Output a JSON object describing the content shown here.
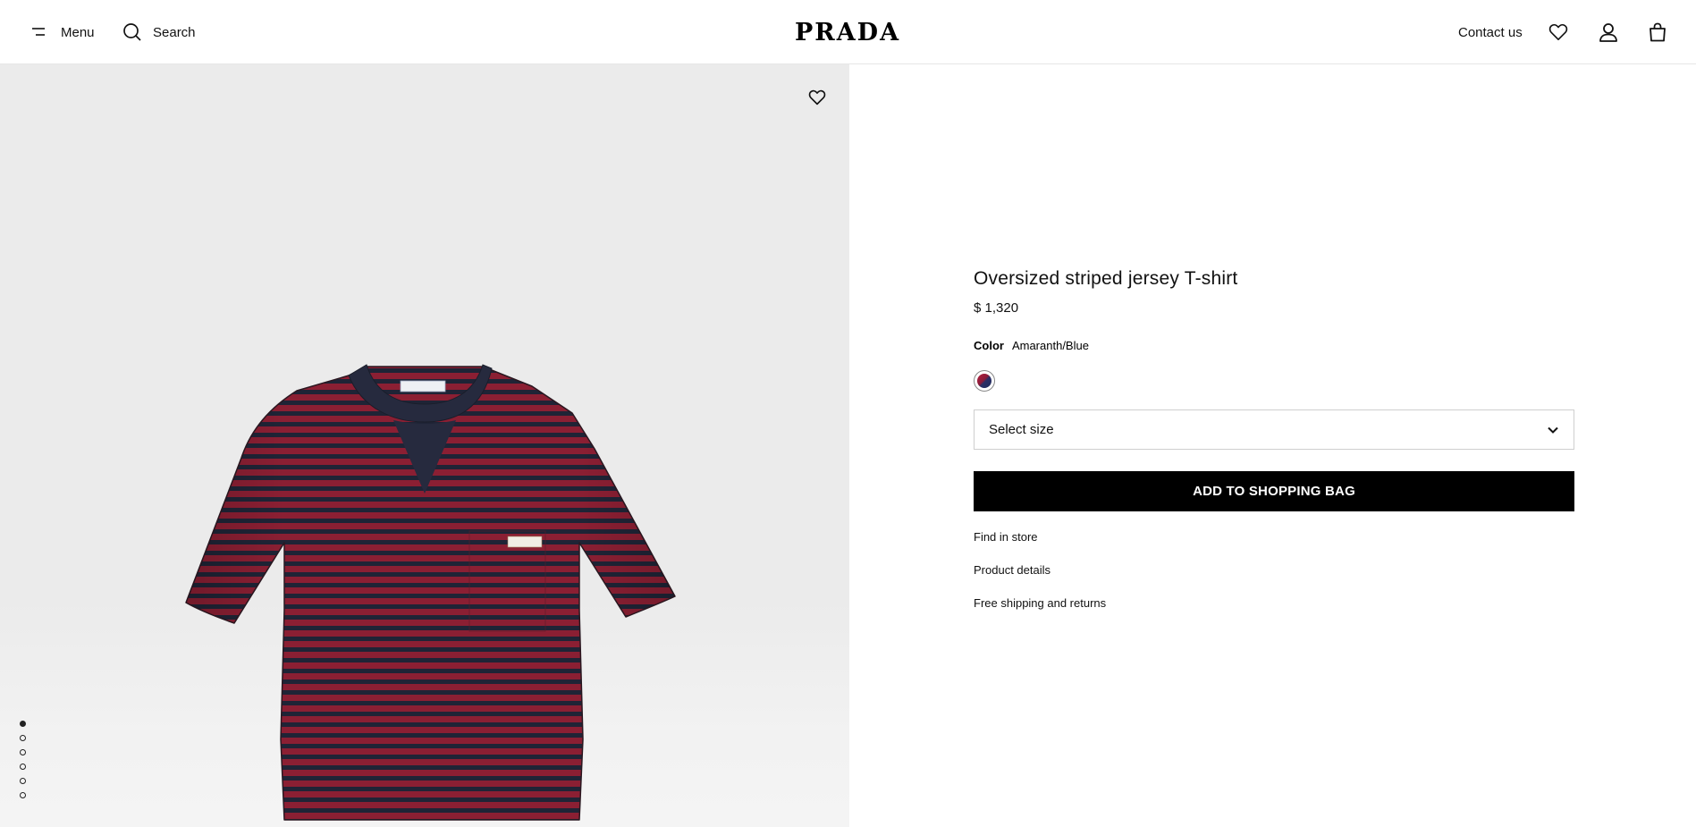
{
  "header": {
    "menu_label": "Menu",
    "search_label": "Search",
    "logo_text": "PRADA",
    "contact_label": "Contact us",
    "icons": [
      "menu-icon",
      "search-icon",
      "heart-icon",
      "user-icon",
      "bag-icon"
    ]
  },
  "gallery": {
    "image_count": 6,
    "active_index": 0,
    "product_colors": {
      "stripe_red": "#8b1f33",
      "stripe_navy": "#1f2436",
      "background": "#ebebeb"
    }
  },
  "product": {
    "name": "Oversized striped jersey T-shirt",
    "price": "$ 1,320",
    "color_label": "Color",
    "color_value": "Amaranth/Blue",
    "size_placeholder": "Select size",
    "add_to_bag_label": "ADD TO SHOPPING BAG",
    "links": {
      "find_in_store": "Find in store",
      "product_details": "Product details",
      "shipping": "Free shipping and returns"
    }
  }
}
